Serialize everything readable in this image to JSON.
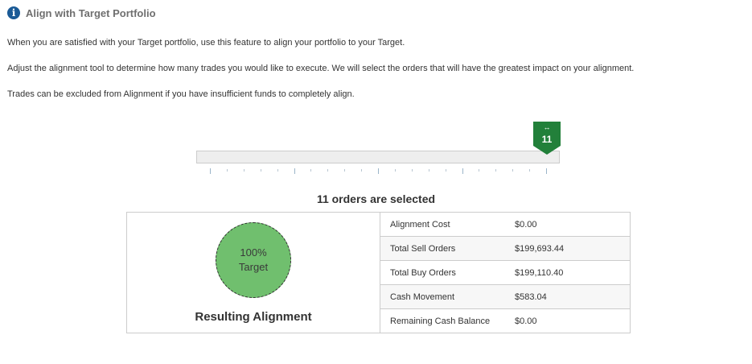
{
  "header": {
    "title": "Align with Target Portfolio",
    "icon": "info-icon"
  },
  "instructions": [
    "When you are satisfied with your Target portfolio, use this feature to align your portfolio to your Target.",
    "Adjust the alignment tool to determine how many trades you would like to execute. We will select the orders that will have the greatest impact on your alignment.",
    "Trades can be excluded from Alignment if you have insufficient funds to completely align."
  ],
  "slider": {
    "value": "11",
    "grip_glyph": "↔",
    "handle_color": "#22803a"
  },
  "orders_selected": "11 orders are selected",
  "alignment": {
    "percent": "100%",
    "target_label": "Target",
    "title": "Resulting Alignment",
    "circle_color": "#70bf6e"
  },
  "summary_rows": [
    {
      "label": "Alignment Cost",
      "value": "$0.00"
    },
    {
      "label": "Total Sell Orders",
      "value": "$199,693.44"
    },
    {
      "label": "Total Buy Orders",
      "value": "$199,110.40"
    },
    {
      "label": "Cash Movement",
      "value": "$583.04"
    },
    {
      "label": "Remaining Cash Balance",
      "value": "$0.00"
    }
  ]
}
